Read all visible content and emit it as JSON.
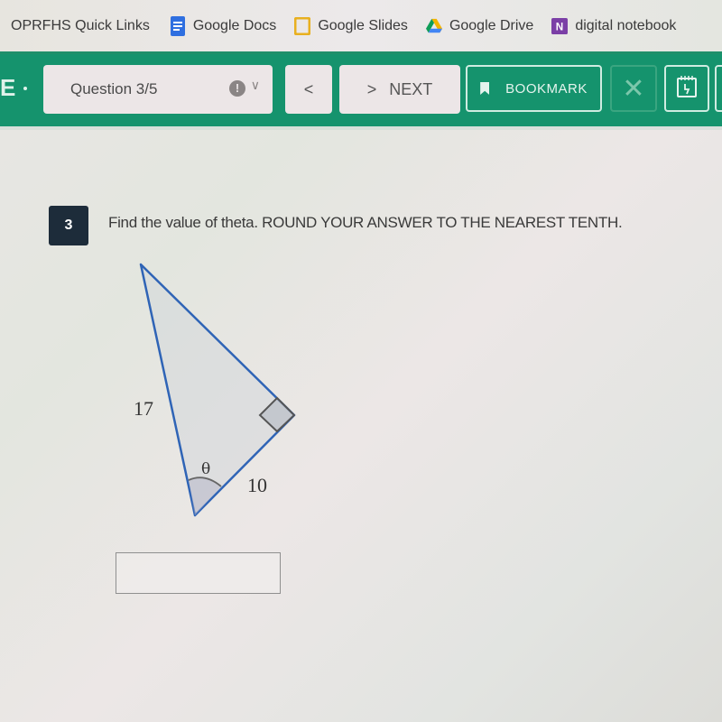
{
  "bookmarks": [
    {
      "label": "OPRFHS Quick Links",
      "icon": "none"
    },
    {
      "label": "Google Docs",
      "icon": "google-docs-icon",
      "color": "#2f6fe0"
    },
    {
      "label": "Google Slides",
      "icon": "google-slides-icon",
      "color": "#e8b020"
    },
    {
      "label": "Google Drive",
      "icon": "google-drive-icon"
    },
    {
      "label": "digital notebook",
      "icon": "onenote-icon",
      "color": "#7b3fa6"
    }
  ],
  "toolbar": {
    "logo": "E",
    "question_selector": "Question 3/5",
    "flag_glyph": "!",
    "prev_glyph": "<",
    "next_glyph": ">",
    "next_label": "NEXT",
    "bookmark_label": "BOOKMARK",
    "close_glyph": "✕",
    "accent_color": "#15936d"
  },
  "question": {
    "number": "3",
    "text": "Find the value of theta.  ROUND YOUR ANSWER TO THE NEAREST TENTH.",
    "diagram": {
      "hypotenuse_label": "17",
      "adjacent_label": "10",
      "angle_label": "θ",
      "right_angle": true
    },
    "answer_value": ""
  }
}
